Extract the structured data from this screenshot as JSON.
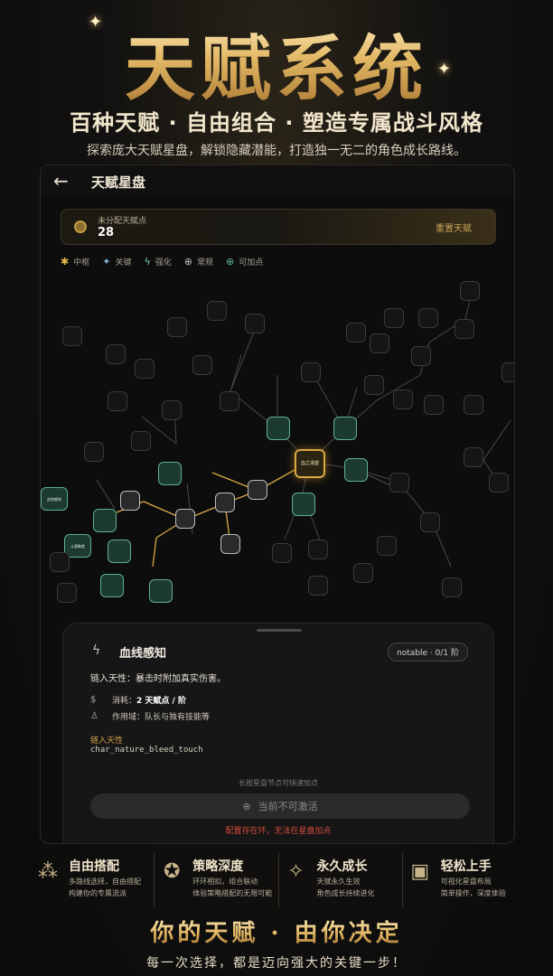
{
  "hero": {
    "title": "天赋系统",
    "subtitle": "百种天赋 · 自由组合 · 塑造专属战斗风格",
    "description": "探索庞大天赋星盘，解锁隐藏潜能，打造独一无二的角色成长路线。"
  },
  "app": {
    "page_title": "天赋星盘",
    "back_icon": "back-arrow-icon",
    "points": {
      "label": "未分配天赋点",
      "value": "28"
    },
    "reset_label": "重置天赋",
    "legend": [
      {
        "icon": "star-icon",
        "label": "中枢",
        "color": "#e6b84a"
      },
      {
        "icon": "sparkle-icon",
        "label": "关键",
        "color": "#7fb3d6"
      },
      {
        "icon": "bolt-icon",
        "label": "强化",
        "color": "#7fd1b0"
      },
      {
        "icon": "plus-circle-icon",
        "label": "常规",
        "color": "#bbbbbb"
      },
      {
        "icon": "plus-circle-icon",
        "label": "可加点",
        "color": "#5fb08e"
      }
    ],
    "tree": {
      "hub_label": "血之渴望",
      "active_labels": [
        "血线感知",
        "斗意聚焦"
      ]
    },
    "sheet": {
      "title": "血线感知",
      "icon": "bolt-icon",
      "badge": "notable · 0/1 阶",
      "description": "链入天性：暴击时附加真实伤害。",
      "cost_label": "消耗：",
      "cost_value": "2 天赋点 / 阶",
      "scope_label": "作用域：",
      "scope_value": "队长与独有技能等",
      "nature_label": "链入天性",
      "nature_value": "char_nature_bleed_touch",
      "hint": "长按星盘节点可快速加点",
      "activate_label": "当前不可激活",
      "warning": "配置存在环，无法在星盘加点"
    }
  },
  "features": [
    {
      "icon": "nodes-icon",
      "title": "自由搭配",
      "line1": "多路线选择，自由搭配",
      "line2": "构建你的专属流派"
    },
    {
      "icon": "star-badge-icon",
      "title": "策略深度",
      "line1": "环环相扣，组合联动",
      "line2": "体验策略搭配的无限可能"
    },
    {
      "icon": "growth-icon",
      "title": "永久成长",
      "line1": "天赋永久生效",
      "line2": "角色成长持续进化"
    },
    {
      "icon": "screen-icon",
      "title": "轻松上手",
      "line1": "可视化星盘布局",
      "line2": "简单操作，深度体验"
    }
  ],
  "footer": {
    "title": "你的天赋 · 由你决定",
    "subtitle": "每一次选择，都是迈向强大的关键一步！"
  }
}
